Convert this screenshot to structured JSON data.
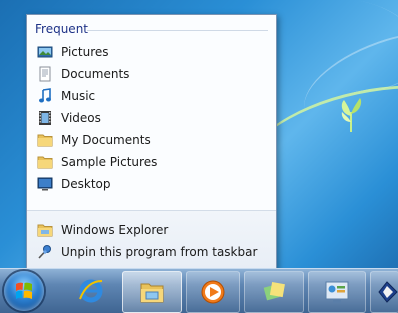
{
  "jumplist": {
    "header": "Frequent",
    "frequent_items": [
      {
        "label": "Pictures",
        "icon": "pictures-library-icon"
      },
      {
        "label": "Documents",
        "icon": "documents-library-icon"
      },
      {
        "label": "Music",
        "icon": "music-library-icon"
      },
      {
        "label": "Videos",
        "icon": "videos-library-icon"
      },
      {
        "label": "My Documents",
        "icon": "folder-icon"
      },
      {
        "label": "Sample Pictures",
        "icon": "folder-icon"
      },
      {
        "label": "Desktop",
        "icon": "desktop-icon"
      }
    ],
    "tasks": [
      {
        "label": "Windows Explorer",
        "icon": "windows-explorer-icon"
      },
      {
        "label": "Unpin this program from taskbar",
        "icon": "unpin-icon"
      }
    ]
  },
  "taskbar": {
    "start": {
      "icon": "windows-start-orb-icon"
    },
    "buttons": [
      {
        "name": "internet-explorer",
        "icon": "internet-explorer-icon"
      },
      {
        "name": "windows-explorer",
        "icon": "windows-explorer-icon"
      },
      {
        "name": "media-player",
        "icon": "media-player-icon"
      },
      {
        "name": "sticky-app",
        "icon": "generic-app-icon"
      },
      {
        "name": "control-panel",
        "icon": "control-panel-icon"
      },
      {
        "name": "partial-app",
        "icon": "partial-app-icon"
      }
    ]
  },
  "colors": {
    "accent": "#1e3287",
    "taskbar": "#4f77a4",
    "desktop": "#2a8fd6"
  }
}
